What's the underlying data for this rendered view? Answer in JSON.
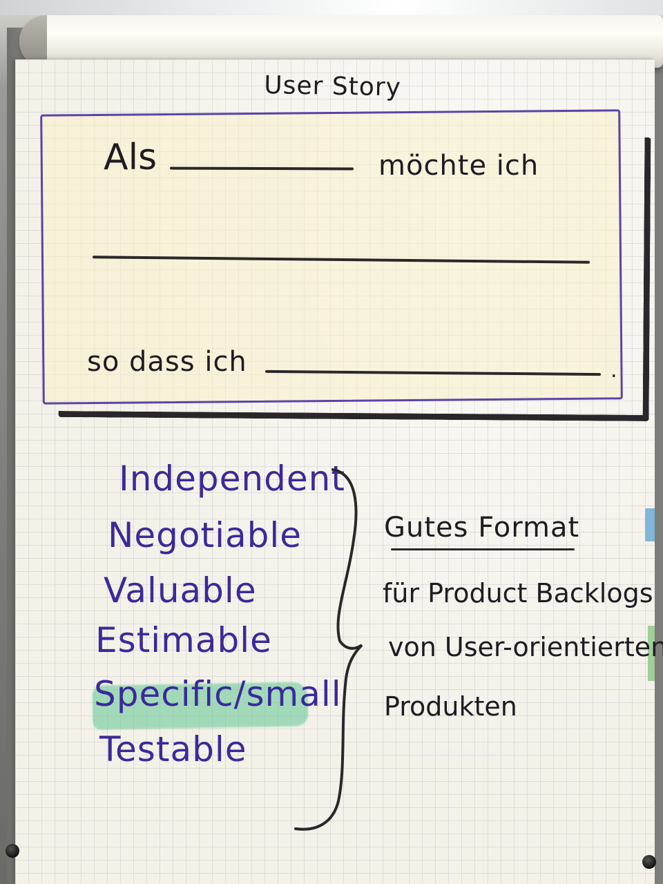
{
  "flipchart": {
    "title": "User Story",
    "story_template": {
      "als": "Als",
      "moechte": "möchte ich",
      "so_dass": "so dass ich",
      "period": "."
    },
    "invest": [
      "Independent",
      "Negotiable",
      "Valuable",
      "Estimable",
      "Specific/small",
      "Testable"
    ],
    "note": {
      "heading": "Gutes Format",
      "line1": "für Product Backlogs",
      "line2": "von User-orientierten",
      "line3": "Produkten"
    }
  },
  "colors": {
    "paper": "#f4f1e9",
    "ink_black": "#1f1b22",
    "ink_purple": "#3a2a9a",
    "card_border": "#5b43a8",
    "card_fill": "#f7f0c8",
    "highlight_green": "#5ec691"
  }
}
